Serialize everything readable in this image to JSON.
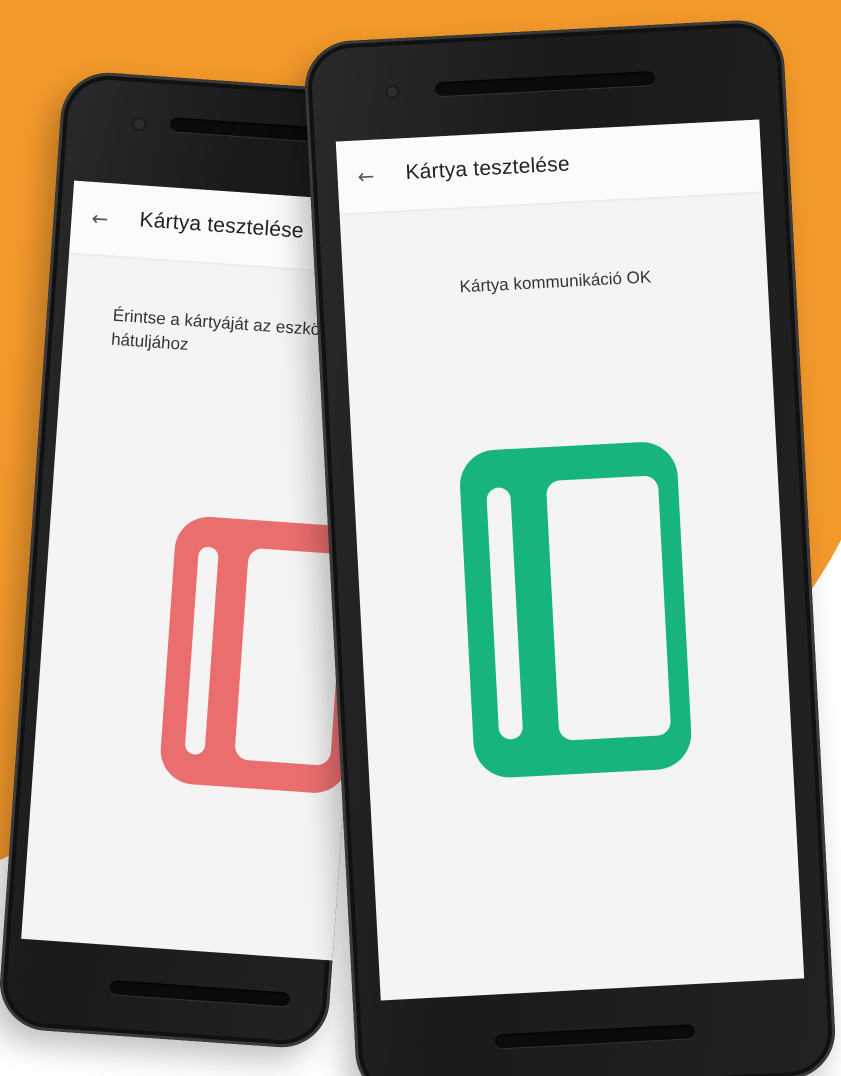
{
  "colors": {
    "background_accent": "#F49A2C",
    "card_error": "#EA6E6E",
    "card_success": "#17B57C",
    "screen_bg": "#F4F4F4",
    "phone_body": "#1E1E1E"
  },
  "phones": [
    {
      "status": "waiting",
      "appbar": {
        "back_icon": "arrow-left-icon",
        "title": "Kártya tesztelése"
      },
      "message": "Érintse a kártyáját az eszköz hátuljához",
      "card_icon": "credit-card-icon",
      "card_color": "#EA6E6E"
    },
    {
      "status": "success",
      "appbar": {
        "back_icon": "arrow-left-icon",
        "title": "Kártya tesztelése"
      },
      "message": "Kártya kommunikáció OK",
      "card_icon": "credit-card-icon",
      "card_color": "#17B57C"
    }
  ]
}
